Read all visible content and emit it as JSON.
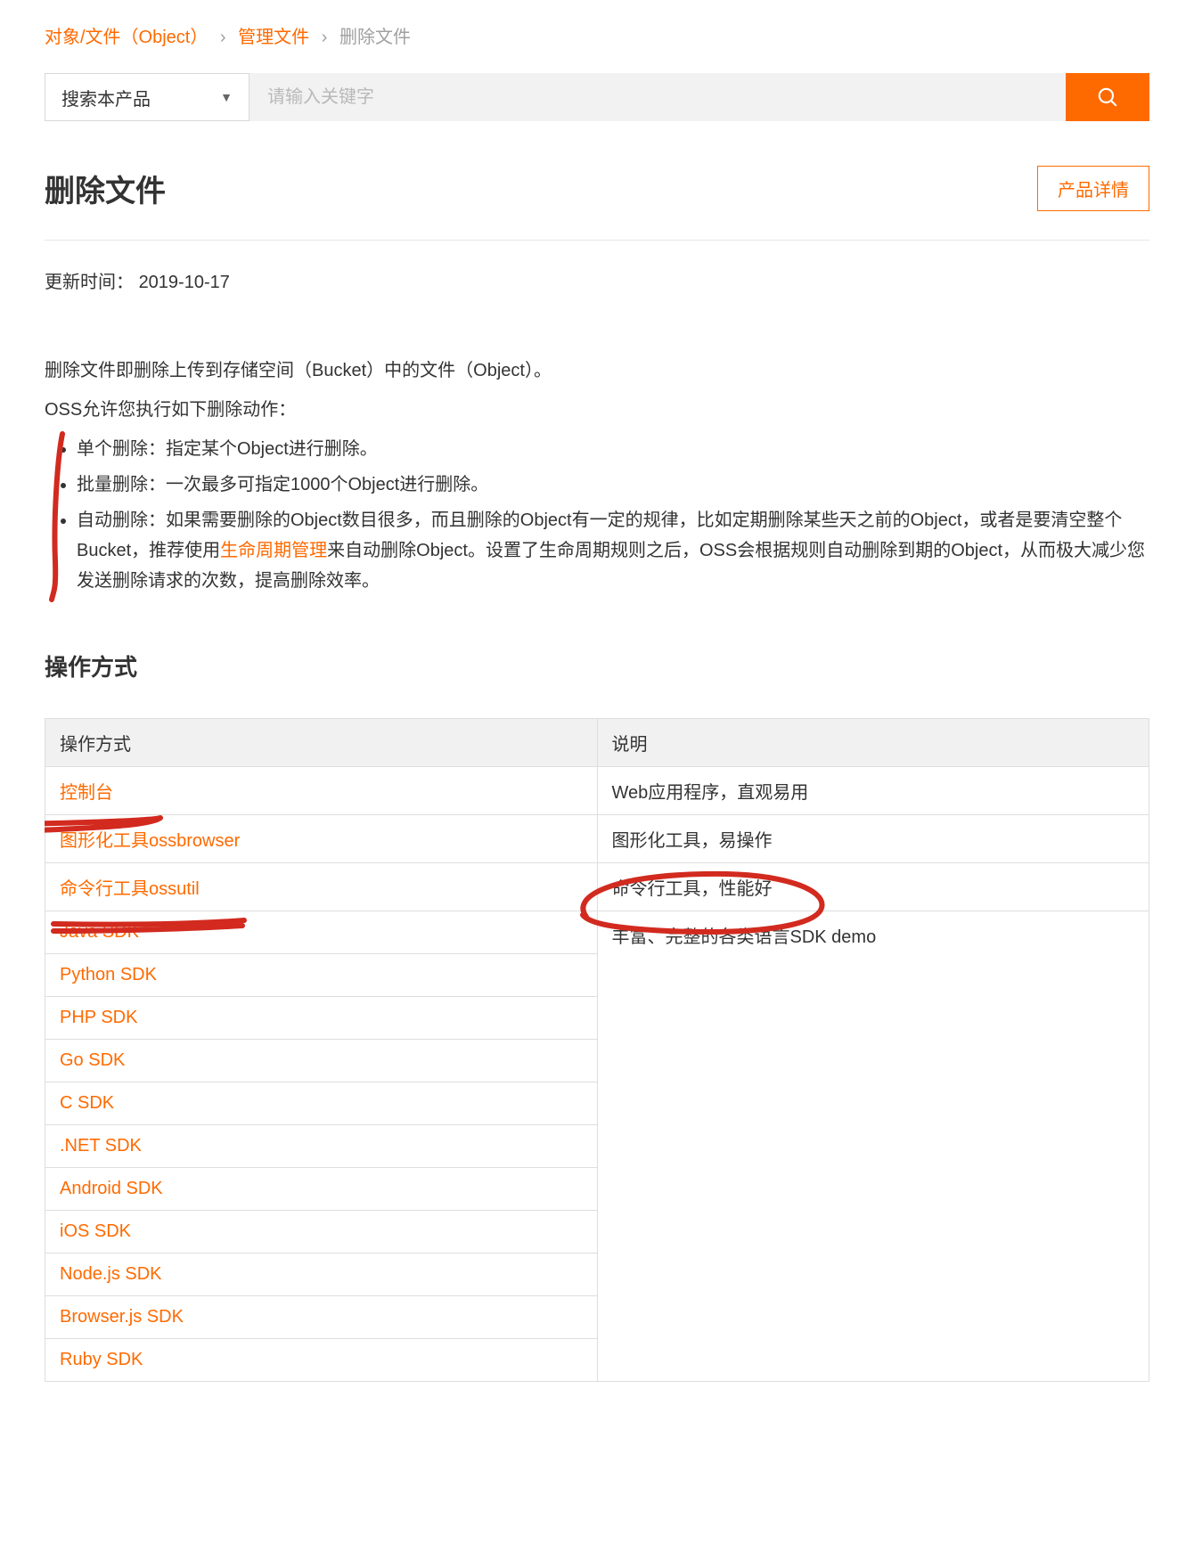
{
  "breadcrumb": {
    "root": "对象/文件（Object）",
    "mid": "管理文件",
    "current": "删除文件"
  },
  "search": {
    "select_label": "搜索本产品",
    "placeholder": "请输入关键字"
  },
  "title": "删除文件",
  "detail_btn": "产品详情",
  "update_label": "更新时间：",
  "update_value": "2019-10-17",
  "intro1": "删除文件即删除上传到存储空间（Bucket）中的文件（Object）。",
  "intro2": "OSS允许您执行如下删除动作：",
  "bullets": {
    "b1": "单个删除：指定某个Object进行删除。",
    "b2": "批量删除：一次最多可指定1000个Object进行删除。",
    "b3a": "自动删除：如果需要删除的Object数目很多，而且删除的Object有一定的规律，比如定期删除某些天之前的Object，或者是要清空整个Bucket，推荐使用",
    "b3link": "生命周期管理",
    "b3b": "来自动删除Object。设置了生命周期规则之后，OSS会根据规则自动删除到期的Object，从而极大减少您发送删除请求的次数，提高删除效率。"
  },
  "section_title": "操作方式",
  "table": {
    "h1": "操作方式",
    "h2": "说明",
    "rows": [
      {
        "name": "控制台",
        "desc": "Web应用程序，直观易用"
      },
      {
        "name": "图形化工具ossbrowser",
        "desc": "图形化工具，易操作"
      },
      {
        "name": "命令行工具ossutil",
        "desc": "命令行工具，性能好"
      },
      {
        "name": "Java SDK",
        "desc": "丰富、完整的各类语言SDK demo"
      },
      {
        "name": "Python SDK",
        "desc": ""
      },
      {
        "name": "PHP SDK",
        "desc": ""
      },
      {
        "name": "Go SDK",
        "desc": ""
      },
      {
        "name": "C SDK",
        "desc": ""
      },
      {
        "name": ".NET SDK",
        "desc": ""
      },
      {
        "name": "Android SDK",
        "desc": ""
      },
      {
        "name": "iOS SDK",
        "desc": ""
      },
      {
        "name": "Node.js SDK",
        "desc": ""
      },
      {
        "name": "Browser.js SDK",
        "desc": ""
      },
      {
        "name": "Ruby SDK",
        "desc": ""
      }
    ]
  }
}
